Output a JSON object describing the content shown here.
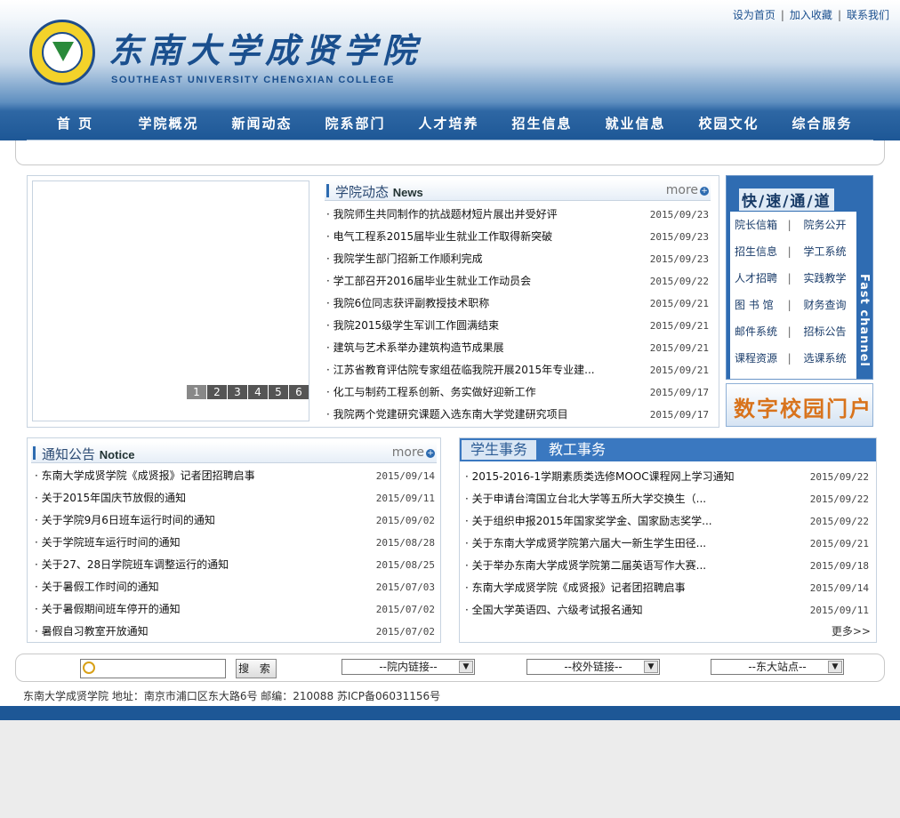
{
  "header": {
    "logo_text": "东南大学成贤学院",
    "logo_subtitle": "SOUTHEAST UNIVERSITY CHENGXIAN COLLEGE",
    "top_links": [
      "设为首页",
      "加入收藏",
      "联系我们"
    ]
  },
  "nav": [
    "首 页",
    "学院概况",
    "新闻动态",
    "院系部门",
    "人才培养",
    "招生信息",
    "就业信息",
    "校园文化",
    "综合服务"
  ],
  "slideshow": {
    "pages": [
      "1",
      "2",
      "3",
      "4",
      "5",
      "6"
    ]
  },
  "news": {
    "title": "学院动态",
    "title_en": "News",
    "more": "more",
    "items": [
      {
        "title": "我院师生共同制作的抗战题材短片展出并受好评",
        "date": "2015/09/23"
      },
      {
        "title": "电气工程系2015届毕业生就业工作取得新突破",
        "date": "2015/09/23"
      },
      {
        "title": "我院学生部门招新工作顺利完成",
        "date": "2015/09/23"
      },
      {
        "title": "学工部召开2016届毕业生就业工作动员会",
        "date": "2015/09/22"
      },
      {
        "title": "我院6位同志获评副教授技术职称",
        "date": "2015/09/21"
      },
      {
        "title": "我院2015级学生军训工作圆满结束",
        "date": "2015/09/21"
      },
      {
        "title": "建筑与艺术系举办建筑构造节成果展",
        "date": "2015/09/21"
      },
      {
        "title": "江苏省教育评估院专家组莅临我院开展2015年专业建...",
        "date": "2015/09/21"
      },
      {
        "title": "化工与制药工程系创新、务实做好迎新工作",
        "date": "2015/09/17"
      },
      {
        "title": "我院两个党建研究课题入选东南大学党建研究项目",
        "date": "2015/09/17"
      }
    ]
  },
  "fast_channel": {
    "title": "快/速/通/道",
    "side_label": "Fast channel",
    "rows": [
      [
        "院长信箱",
        "院务公开"
      ],
      [
        "招生信息",
        "学工系统"
      ],
      [
        "人才招聘",
        "实践教学"
      ],
      [
        "图 书 馆",
        "财务查询"
      ],
      [
        "邮件系统",
        "招标公告"
      ],
      [
        "课程资源",
        "选课系统"
      ]
    ],
    "sep": "|"
  },
  "portal": {
    "label": "数字校园门户"
  },
  "notice": {
    "title": "通知公告",
    "title_en": "Notice",
    "more": "more",
    "items": [
      {
        "title": "东南大学成贤学院《成贤报》记者团招聘启事",
        "date": "2015/09/14"
      },
      {
        "title": "关于2015年国庆节放假的通知",
        "date": "2015/09/11"
      },
      {
        "title": "关于学院9月6日班车运行时间的通知",
        "date": "2015/09/02"
      },
      {
        "title": "关于学院班车运行时间的通知",
        "date": "2015/08/28"
      },
      {
        "title": "关于27、28日学院班车调整运行的通知",
        "date": "2015/08/25"
      },
      {
        "title": "关于暑假工作时间的通知",
        "date": "2015/07/03"
      },
      {
        "title": "关于暑假期间班车停开的通知",
        "date": "2015/07/02"
      },
      {
        "title": "暑假自习教室开放通知",
        "date": "2015/07/02"
      }
    ]
  },
  "student": {
    "tabs": [
      "学生事务",
      "教工事务"
    ],
    "more": "更多>>",
    "items": [
      {
        "title": "2015-2016-1学期素质类选修MOOC课程网上学习通知",
        "date": "2015/09/22"
      },
      {
        "title": "关于申请台湾国立台北大学等五所大学交换生（...",
        "date": "2015/09/22"
      },
      {
        "title": "关于组织申报2015年国家奖学金、国家励志奖学...",
        "date": "2015/09/22"
      },
      {
        "title": "关于东南大学成贤学院第六届大一新生学生田径...",
        "date": "2015/09/21"
      },
      {
        "title": "关于举办东南大学成贤学院第二届英语写作大赛...",
        "date": "2015/09/18"
      },
      {
        "title": "东南大学成贤学院《成贤报》记者团招聘启事",
        "date": "2015/09/14"
      },
      {
        "title": "全国大学英语四、六级考试报名通知",
        "date": "2015/09/11"
      }
    ]
  },
  "search": {
    "input_value": "",
    "button_label": "搜 索",
    "select_internal": "--院内链接--",
    "select_external": "--校外链接--",
    "select_sites": "--东大站点--"
  },
  "footer": {
    "text": "东南大学成贤学院  地址：南京市浦口区东大路6号 邮编：210088 苏ICP备06031156号"
  },
  "colors": {
    "brand_blue": "#1d5796",
    "accent_orange": "#d8731c"
  }
}
